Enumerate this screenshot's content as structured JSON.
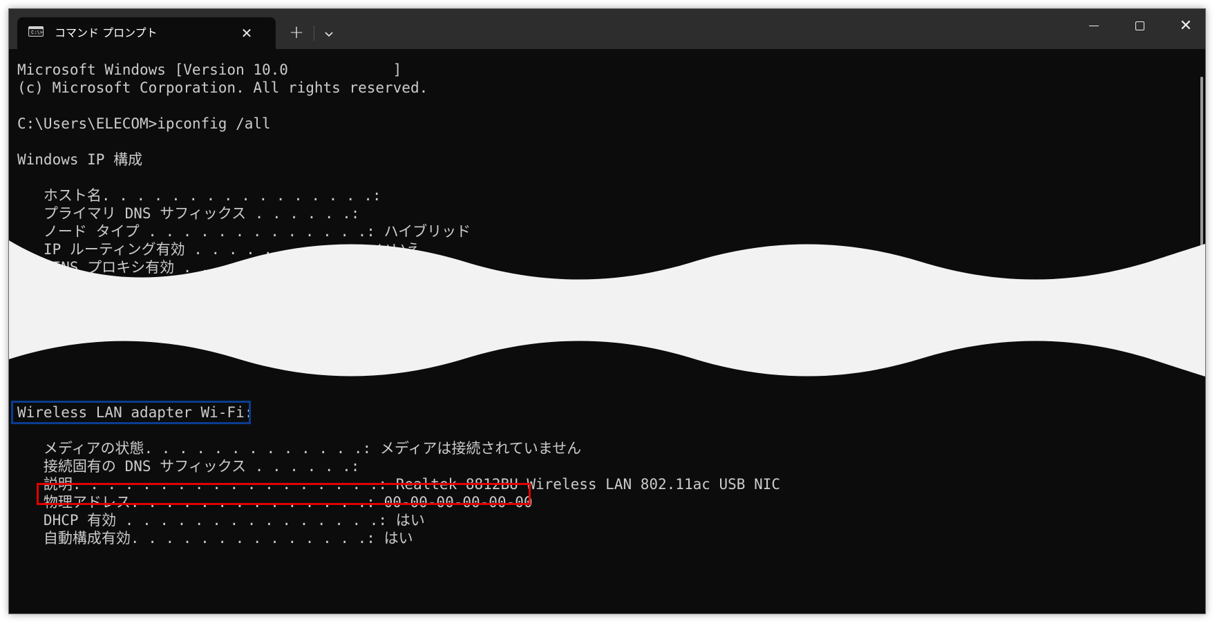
{
  "tab": {
    "icon": "C:\\>",
    "title": "コマンド プロンプト",
    "close": "✕",
    "new_tab": "+",
    "dropdown": "⌄"
  },
  "window_controls": {
    "close": "✕"
  },
  "console": {
    "version_line": "Microsoft Windows [Version 10.0            ]",
    "copyright_line": "(c) Microsoft Corporation. All rights reserved.",
    "prompt_line": "C:\\Users\\ELECOM>ipconfig /all",
    "ip_config_header": "Windows IP 構成",
    "host_name": "   ホスト名. . . . . . . . . . . . . . . .: ",
    "primary_dns_suffix": "   プライマリ DNS サフィックス . . . . . .: ",
    "node_type": "   ノード タイプ . . . . . . . . . . . . .: ハイブリッド",
    "ip_routing": "   IP ルーティング有効 . . . . . . . . . .: いいえ",
    "wins_proxy": "   WINS プロキシ有効 . . . . . . . . . . .: いいえ",
    "adapter_header": "Wireless LAN adapter Wi-Fi:",
    "media_state": "   メディアの状態. . . . . . . . . . . . .: メディアは接続されていません",
    "conn_dns_suffix": "   接続固有の DNS サフィックス . . . . . .: ",
    "description": "   説明. . . . . . . . . . . . . . . . . .: Realtek 8812BU Wireless LAN 802.11ac USB NIC",
    "physical_address": "   物理アドレス. . . . . . . . . . . . . .: 00-00-00-00-00-00",
    "dhcp_enabled": "   DHCP 有効 . . . . . . . . . . . . . . .: はい",
    "autoconfig_enabled": "   自動構成有効. . . . . . . . . . . . . .: はい"
  },
  "colors": {
    "console_bg": "#0c0c0c",
    "console_text": "#cccccc",
    "highlight_blue": "#0a3d91",
    "highlight_red": "#e10000",
    "cut_fill": "#f2f2f2"
  }
}
